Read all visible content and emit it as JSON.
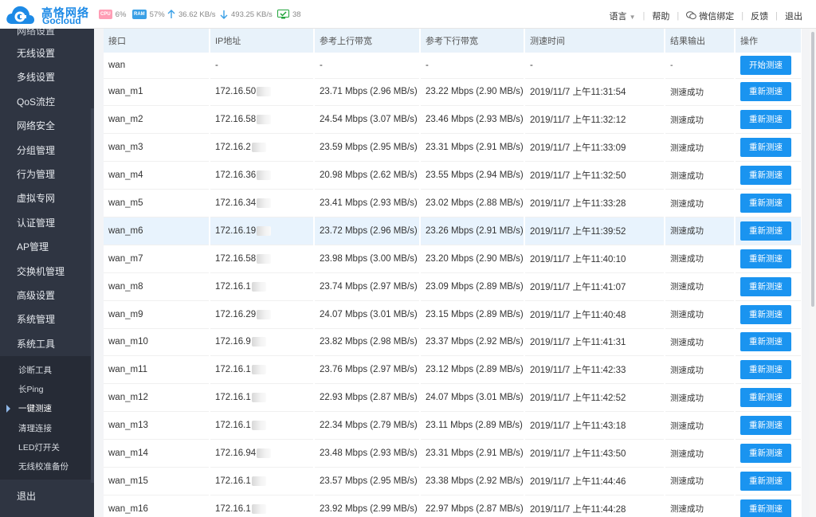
{
  "brand": {
    "name_cn": "高恪网络",
    "name_en": "Gocloud"
  },
  "status_bar": {
    "cpu_label": "CPU",
    "cpu_value": "6%",
    "ram_label": "RAM",
    "ram_value": "57%",
    "upload": "36.62 KB/s",
    "download": "493.25 KB/s",
    "connections": "38"
  },
  "nav": {
    "language": "语言",
    "help": "帮助",
    "wechat": "微信绑定",
    "feedback": "反馈",
    "logout": "退出"
  },
  "sidebar": {
    "items": [
      "网络设置",
      "无线设置",
      "多线设置",
      "QoS流控",
      "网络安全",
      "分组管理",
      "行为管理",
      "虚拟专网",
      "认证管理",
      "AP管理",
      "交换机管理",
      "高级设置",
      "系统管理",
      "系统工具"
    ],
    "sub_items": [
      "诊断工具",
      "长Ping",
      "一键测速",
      "清理连接",
      "LED灯开关",
      "无线校准备份"
    ],
    "active_sub": 2,
    "bottom": "退出"
  },
  "table": {
    "columns": [
      "接口",
      "IP地址",
      "参考上行带宽",
      "参考下行带宽",
      "测速时间",
      "结果输出",
      "操作"
    ],
    "rows": [
      {
        "iface": "wan",
        "ip": "-",
        "up": "-",
        "down": "-",
        "time": "-",
        "result": "-",
        "action": "开始测速"
      },
      {
        "iface": "wan_m1",
        "ip": "172.16.50",
        "up": "23.71 Mbps (2.96 MB/s)",
        "down": "23.22 Mbps (2.90 MB/s)",
        "time": "2019/11/7 上午11:31:54",
        "result": "测速成功",
        "action": "重新测速"
      },
      {
        "iface": "wan_m2",
        "ip": "172.16.58",
        "up": "24.54 Mbps (3.07 MB/s)",
        "down": "23.46 Mbps (2.93 MB/s)",
        "time": "2019/11/7 上午11:32:12",
        "result": "测速成功",
        "action": "重新测速"
      },
      {
        "iface": "wan_m3",
        "ip": "172.16.2",
        "up": "23.59 Mbps (2.95 MB/s)",
        "down": "23.31 Mbps (2.91 MB/s)",
        "time": "2019/11/7 上午11:33:09",
        "result": "测速成功",
        "action": "重新测速"
      },
      {
        "iface": "wan_m4",
        "ip": "172.16.36",
        "up": "20.98 Mbps (2.62 MB/s)",
        "down": "23.55 Mbps (2.94 MB/s)",
        "time": "2019/11/7 上午11:32:50",
        "result": "测速成功",
        "action": "重新测速"
      },
      {
        "iface": "wan_m5",
        "ip": "172.16.34",
        "up": "23.41 Mbps (2.93 MB/s)",
        "down": "23.02 Mbps (2.88 MB/s)",
        "time": "2019/11/7 上午11:33:28",
        "result": "测速成功",
        "action": "重新测速"
      },
      {
        "iface": "wan_m6",
        "ip": "172.16.19",
        "up": "23.72 Mbps (2.96 MB/s)",
        "down": "23.26 Mbps (2.91 MB/s)",
        "time": "2019/11/7 上午11:39:52",
        "result": "测速成功",
        "action": "重新测速"
      },
      {
        "iface": "wan_m7",
        "ip": "172.16.58",
        "up": "23.98 Mbps (3.00 MB/s)",
        "down": "23.20 Mbps (2.90 MB/s)",
        "time": "2019/11/7 上午11:40:10",
        "result": "测速成功",
        "action": "重新测速"
      },
      {
        "iface": "wan_m8",
        "ip": "172.16.1",
        "up": "23.74 Mbps (2.97 MB/s)",
        "down": "23.09 Mbps (2.89 MB/s)",
        "time": "2019/11/7 上午11:41:07",
        "result": "测速成功",
        "action": "重新测速"
      },
      {
        "iface": "wan_m9",
        "ip": "172.16.29",
        "up": "24.07 Mbps (3.01 MB/s)",
        "down": "23.15 Mbps (2.89 MB/s)",
        "time": "2019/11/7 上午11:40:48",
        "result": "测速成功",
        "action": "重新测速"
      },
      {
        "iface": "wan_m10",
        "ip": "172.16.9",
        "up": "23.82 Mbps (2.98 MB/s)",
        "down": "23.37 Mbps (2.92 MB/s)",
        "time": "2019/11/7 上午11:41:31",
        "result": "测速成功",
        "action": "重新测速"
      },
      {
        "iface": "wan_m11",
        "ip": "172.16.1",
        "up": "23.76 Mbps (2.97 MB/s)",
        "down": "23.12 Mbps (2.89 MB/s)",
        "time": "2019/11/7 上午11:42:33",
        "result": "测速成功",
        "action": "重新测速"
      },
      {
        "iface": "wan_m12",
        "ip": "172.16.1",
        "up": "22.93 Mbps (2.87 MB/s)",
        "down": "24.07 Mbps (3.01 MB/s)",
        "time": "2019/11/7 上午11:42:52",
        "result": "测速成功",
        "action": "重新测速"
      },
      {
        "iface": "wan_m13",
        "ip": "172.16.1",
        "up": "22.34 Mbps (2.79 MB/s)",
        "down": "23.11 Mbps (2.89 MB/s)",
        "time": "2019/11/7 上午11:43:18",
        "result": "测速成功",
        "action": "重新测速"
      },
      {
        "iface": "wan_m14",
        "ip": "172.16.94",
        "up": "23.48 Mbps (2.93 MB/s)",
        "down": "23.31 Mbps (2.91 MB/s)",
        "time": "2019/11/7 上午11:43:50",
        "result": "测速成功",
        "action": "重新测速"
      },
      {
        "iface": "wan_m15",
        "ip": "172.16.1",
        "up": "23.57 Mbps (2.95 MB/s)",
        "down": "23.38 Mbps (2.92 MB/s)",
        "time": "2019/11/7 上午11:44:46",
        "result": "测速成功",
        "action": "重新测速"
      },
      {
        "iface": "wan_m16",
        "ip": "172.16.1",
        "up": "23.92 Mbps (2.99 MB/s)",
        "down": "22.97 Mbps (2.87 MB/s)",
        "time": "2019/11/7 上午11:44:28",
        "result": "测速成功",
        "action": "重新测速"
      }
    ],
    "highlighted_row": 6
  },
  "colors": {
    "sidebar_bg": "#2f3542",
    "accent": "#1a94f0",
    "header_bg": "#e8f2fa",
    "row_highlight": "#e8f3fd"
  }
}
